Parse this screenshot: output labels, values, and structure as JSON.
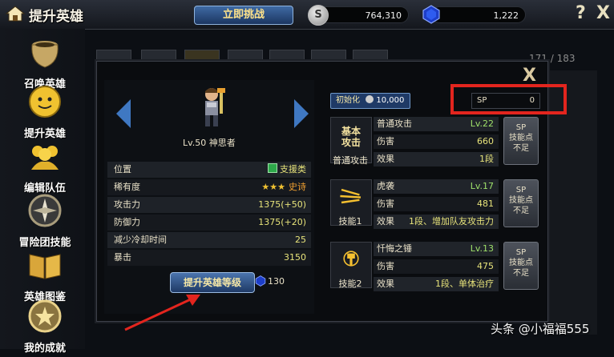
{
  "header": {
    "title": "提升英雄",
    "challenge_label": "立即挑战",
    "silver_label": "S",
    "silver_amount": "764,310",
    "gem_amount": "1,222",
    "help_label": "?",
    "close_label": "X"
  },
  "sidebar": {
    "items": [
      {
        "label": "召唤英雄",
        "icon": "pot-icon"
      },
      {
        "label": "提升英雄",
        "icon": "level-up-icon"
      },
      {
        "label": "编辑队伍",
        "icon": "team-icon"
      },
      {
        "label": "冒险团技能",
        "icon": "compass-icon"
      },
      {
        "label": "英雄图鉴",
        "icon": "book-icon"
      },
      {
        "label": "我的成就",
        "icon": "medal-icon"
      }
    ]
  },
  "background": {
    "count": "171 / 183"
  },
  "modal": {
    "close_label": "X",
    "hero": {
      "level": "Lv.50",
      "name": "神思者"
    },
    "stats": [
      {
        "label": "位置",
        "value": "支援类"
      },
      {
        "label": "稀有度",
        "value": "史诗",
        "stars": 3
      },
      {
        "label": "攻击力",
        "value": "1375(+50)"
      },
      {
        "label": "防御力",
        "value": "1375(+20)"
      },
      {
        "label": "减少冷却时间",
        "value": "25"
      },
      {
        "label": "暴击",
        "value": "3150"
      }
    ],
    "upgrade_label": "提升英雄等级",
    "upgrade_cost": "130",
    "init_label": "初始化",
    "init_cost": "10,000",
    "sp_label": "SP",
    "sp_value": "0",
    "skills": [
      {
        "card_text": "基本\n攻击",
        "name": "普通攻击",
        "title": "普通攻击",
        "level": "Lv.22",
        "damage_label": "伤害",
        "damage": "660",
        "effect_label": "效果",
        "effect": "1段",
        "sp_btn": "SP\n技能点\n不足"
      },
      {
        "name": "技能1",
        "title": "虎袭",
        "level": "Lv.17",
        "damage_label": "伤害",
        "damage": "481",
        "effect_label": "效果",
        "effect": "1段、增加队友攻击力",
        "sp_btn": "SP\n技能点\n不足"
      },
      {
        "name": "技能2",
        "title": "忏悔之锤",
        "level": "Lv.13",
        "damage_label": "伤害",
        "damage": "475",
        "effect_label": "效果",
        "effect": "1段、单体治疗",
        "sp_btn": "SP\n技能点\n不足"
      }
    ]
  },
  "watermark": "头条 @小福福555",
  "colors": {
    "highlight": "#e3251e",
    "accent_blue": "#3f78c2",
    "value_yellow": "#e7e37a"
  }
}
